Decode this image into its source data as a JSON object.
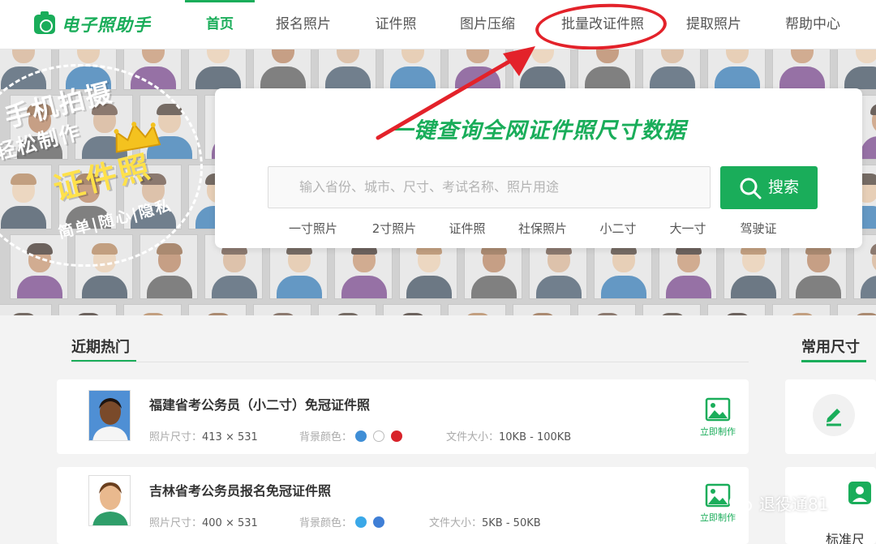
{
  "header": {
    "logo_text": "电子照助手",
    "nav": [
      {
        "label": "首页",
        "active": true
      },
      {
        "label": "报名照片",
        "active": false
      },
      {
        "label": "证件照",
        "active": false
      },
      {
        "label": "图片压缩",
        "active": false
      },
      {
        "label": "批量改证件照",
        "active": false
      },
      {
        "label": "提取照片",
        "active": false
      },
      {
        "label": "帮助中心",
        "active": false
      }
    ]
  },
  "hero": {
    "badge": {
      "line1": "手机拍摄",
      "line2": "轻松制作",
      "line3": "证件照",
      "line4": "简单|随心|隐私"
    },
    "search_title": "一键查询全网证件照尺寸数据",
    "search_placeholder": "输入省份、城市、尺寸、考试名称、照片用途",
    "search_button": "搜索",
    "quick_tags": [
      "一寸照片",
      "2寸照片",
      "证件照",
      "社保照片",
      "小二寸",
      "大一寸",
      "驾驶证"
    ]
  },
  "recent": {
    "title": "近期热门",
    "items": [
      {
        "title": "福建省考公务员（小二寸）免冠证件照",
        "size_label": "照片尺寸：",
        "size_value": "413 × 531",
        "bg_label": "背景颜色：",
        "bg_colors": [
          "#3f8ed6",
          "#ffffff",
          "#d8232a"
        ],
        "file_label": "文件大小：",
        "file_value": "10KB - 100KB",
        "action": "立即制作"
      },
      {
        "title": "吉林省考公务员报名免冠证件照",
        "size_label": "照片尺寸：",
        "size_value": "400 × 531",
        "bg_label": "背景颜色：",
        "bg_colors": [
          "#3aa8e8",
          "#3f7fd6"
        ],
        "file_label": "文件大小：",
        "file_value": "5KB - 50KB",
        "action": "立即制作"
      }
    ]
  },
  "sidebar": {
    "title": "常用尺寸",
    "std_label": "标准尺寸"
  },
  "watermark": {
    "text": "退役通81"
  },
  "colors": {
    "accent": "#1aad5a",
    "highlight": "#e3222a"
  }
}
